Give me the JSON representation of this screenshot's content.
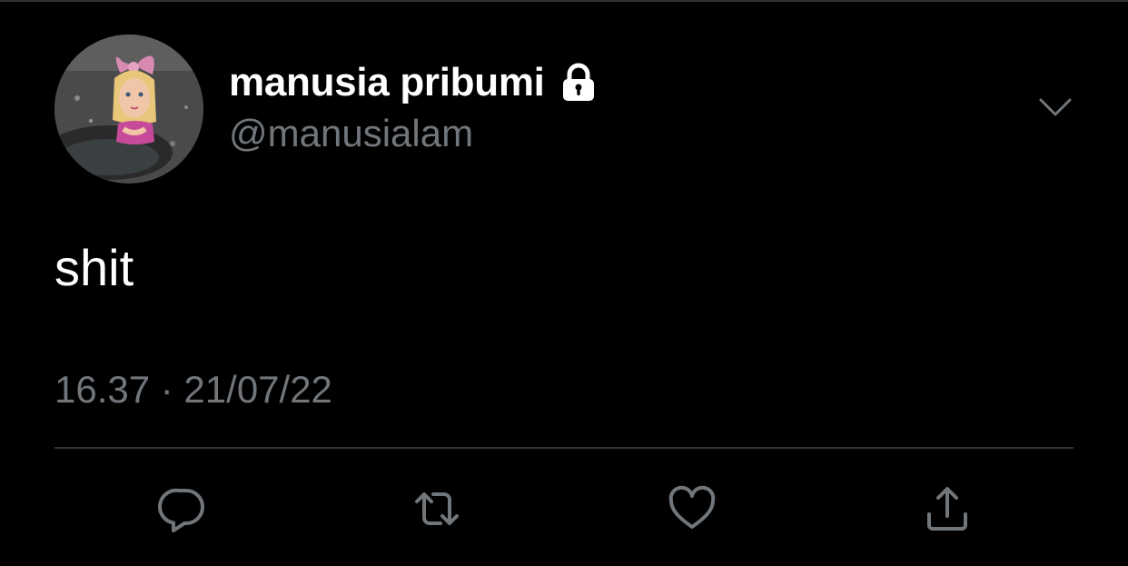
{
  "tweet": {
    "display_name": "manusia pribumi",
    "handle": "@manusialam",
    "text": "shit",
    "timestamp": "16.37 · 21/07/22",
    "protected": true
  },
  "icons": {
    "lock": "lock-icon",
    "more": "chevron-down-icon",
    "reply": "reply-icon",
    "retweet": "retweet-icon",
    "like": "heart-icon",
    "share": "share-icon"
  },
  "colors": {
    "background": "#000000",
    "primary_text": "#ffffff",
    "secondary_text": "#71767b",
    "divider": "#2f3336",
    "icon": "#71767b"
  }
}
